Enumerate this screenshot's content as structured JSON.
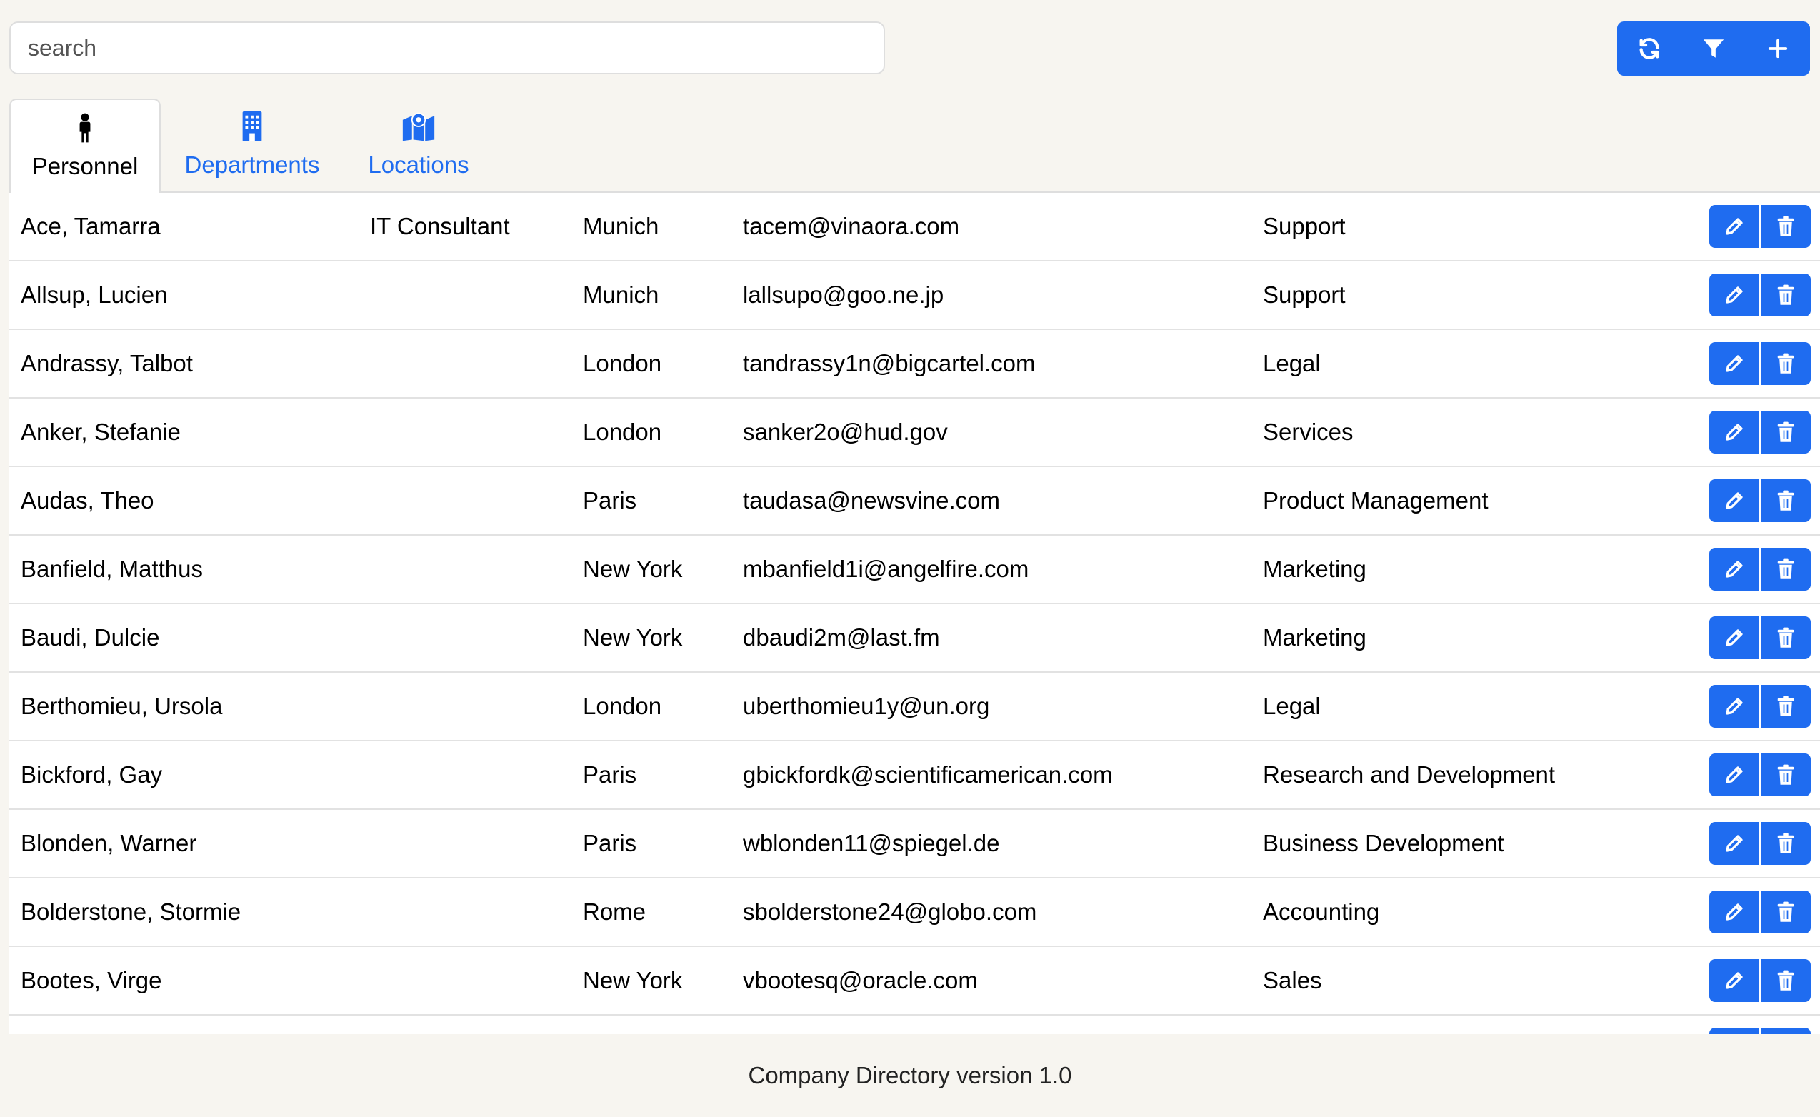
{
  "search": {
    "placeholder": "search",
    "value": ""
  },
  "toolbar": {
    "refresh_icon": "refresh-icon",
    "filter_icon": "filter-icon",
    "add_icon": "plus-icon"
  },
  "tabs": [
    {
      "label": "Personnel",
      "icon": "person-icon",
      "active": true
    },
    {
      "label": "Departments",
      "icon": "building-icon",
      "active": false
    },
    {
      "label": "Locations",
      "icon": "map-icon",
      "active": false
    }
  ],
  "colors": {
    "accent": "#1f6cf0",
    "background": "#f7f5f0"
  },
  "personnel": [
    {
      "name": "Ace, Tamarra",
      "job": "IT Consultant",
      "location": "Munich",
      "email": "tacem@vinaora.com",
      "department": "Support"
    },
    {
      "name": "Allsup, Lucien",
      "job": "",
      "location": "Munich",
      "email": "lallsupo@goo.ne.jp",
      "department": "Support"
    },
    {
      "name": "Andrassy, Talbot",
      "job": "",
      "location": "London",
      "email": "tandrassy1n@bigcartel.com",
      "department": "Legal"
    },
    {
      "name": "Anker, Stefanie",
      "job": "",
      "location": "London",
      "email": "sanker2o@hud.gov",
      "department": "Services"
    },
    {
      "name": "Audas, Theo",
      "job": "",
      "location": "Paris",
      "email": "taudasa@newsvine.com",
      "department": "Product Management"
    },
    {
      "name": "Banfield, Matthus",
      "job": "",
      "location": "New York",
      "email": "mbanfield1i@angelfire.com",
      "department": "Marketing"
    },
    {
      "name": "Baudi, Dulcie",
      "job": "",
      "location": "New York",
      "email": "dbaudi2m@last.fm",
      "department": "Marketing"
    },
    {
      "name": "Berthomieu, Ursola",
      "job": "",
      "location": "London",
      "email": "uberthomieu1y@un.org",
      "department": "Legal"
    },
    {
      "name": "Bickford, Gay",
      "job": "",
      "location": "Paris",
      "email": "gbickfordk@scientificamerican.com",
      "department": "Research and Development"
    },
    {
      "name": "Blonden, Warner",
      "job": "",
      "location": "Paris",
      "email": "wblonden11@spiegel.de",
      "department": "Business Development"
    },
    {
      "name": "Bolderstone, Stormie",
      "job": "",
      "location": "Rome",
      "email": "sbolderstone24@globo.com",
      "department": "Accounting"
    },
    {
      "name": "Bootes, Virge",
      "job": "",
      "location": "New York",
      "email": "vbootesq@oracle.com",
      "department": "Sales"
    },
    {
      "name": "",
      "job": "",
      "location": "",
      "email": "",
      "department": ""
    }
  ],
  "footer": {
    "text": "Company Directory version 1.0"
  }
}
